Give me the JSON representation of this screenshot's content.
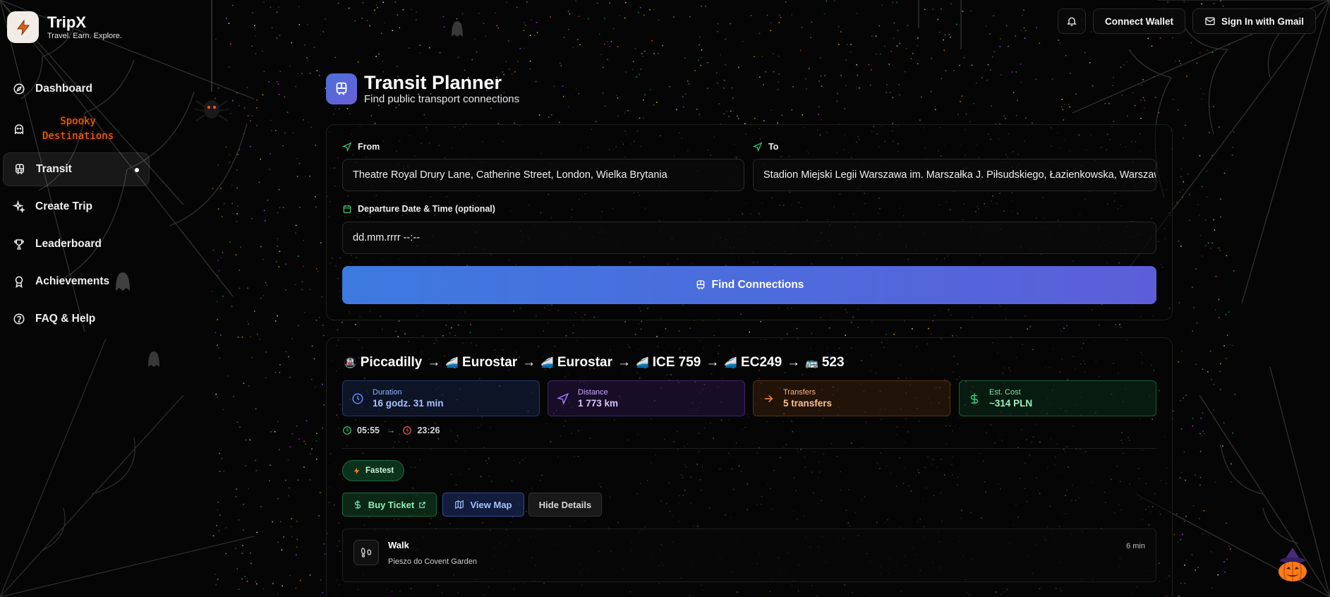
{
  "app": {
    "name": "TripX",
    "tagline": "Travel. Earn. Explore."
  },
  "sidebar": {
    "items": [
      {
        "label": "Dashboard",
        "icon": "compass-icon"
      },
      {
        "label": "Spooky\nDestinations",
        "icon": "ghost-icon"
      },
      {
        "label": "Transit",
        "icon": "train-icon",
        "active": true
      },
      {
        "label": "Create Trip",
        "icon": "sparkles-icon"
      },
      {
        "label": "Leaderboard",
        "icon": "trophy-icon"
      },
      {
        "label": "Achievements",
        "icon": "award-icon"
      },
      {
        "label": "FAQ & Help",
        "icon": "help-circle-icon"
      }
    ]
  },
  "header": {
    "bell_icon": "bell-icon",
    "connect_wallet": "Connect Wallet",
    "sign_in": "Sign In with Gmail"
  },
  "page": {
    "title": "Transit Planner",
    "subtitle": "Find public transport connections"
  },
  "form": {
    "from_label": "From",
    "from_value": "Theatre Royal Drury Lane, Catherine Street, London, Wielka Brytania",
    "to_label": "To",
    "to_value": "Stadion Miejski Legii Warszawa im. Marszałka J. Piłsudskiego, Łazienkowska, Warszawa",
    "date_label": "Departure Date & Time (optional)",
    "date_placeholder": "dd.mm.rrrr --:--",
    "find_button": "Find Connections"
  },
  "route": {
    "legs": [
      {
        "emoji": "🚇",
        "name": "Piccadilly"
      },
      {
        "emoji": "🚄",
        "name": "Eurostar"
      },
      {
        "emoji": "🚄",
        "name": "Eurostar"
      },
      {
        "emoji": "🚄",
        "name": "ICE 759"
      },
      {
        "emoji": "🚄",
        "name": "EC249"
      },
      {
        "emoji": "🚌",
        "name": "523"
      }
    ],
    "arrow": "→",
    "stats": [
      {
        "label": "Duration",
        "value": "16 godz. 31 min",
        "icon": "clock-icon",
        "color": "#5b8cff"
      },
      {
        "label": "Distance",
        "value": "1 773 km",
        "icon": "navigation-icon",
        "color": "#a974ff"
      },
      {
        "label": "Transfers",
        "value": "5 transfers",
        "icon": "arrow-right-icon",
        "color": "#ff8a3d"
      },
      {
        "label": "Est. Cost",
        "value": "~314 PLN",
        "icon": "dollar-icon",
        "color": "#34d27a"
      }
    ],
    "depart": "05:55",
    "arrive": "23:26",
    "badge": "Fastest",
    "buy_ticket": "Buy Ticket",
    "view_map": "View Map",
    "hide_details": "Hide Details",
    "steps": [
      {
        "title": "Walk",
        "description": "Pieszo do Covent Garden",
        "duration": "6 min",
        "icon": "footprints-icon"
      }
    ]
  }
}
